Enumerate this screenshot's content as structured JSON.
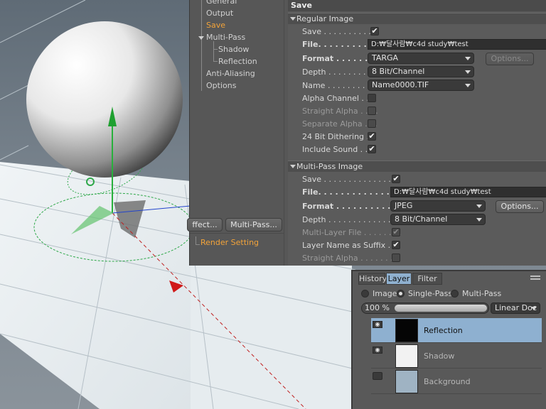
{
  "tree": {
    "items": [
      {
        "label": "General",
        "active": false
      },
      {
        "label": "Output",
        "active": false
      },
      {
        "label": "Save",
        "active": true
      },
      {
        "label": "Multi-Pass",
        "active": false
      },
      {
        "label": "Shadow",
        "active": false
      },
      {
        "label": "Reflection",
        "active": false
      },
      {
        "label": "Anti-Aliasing",
        "active": false
      },
      {
        "label": "Options",
        "active": false
      }
    ],
    "effect_button": "ffect...",
    "multipass_button": "Multi-Pass...",
    "render_setting": "Render Setting"
  },
  "settings": {
    "title": "Save",
    "regular": {
      "header": "Regular Image",
      "save_label": "Save . . . . . . . . . . .",
      "save_checked": "✔",
      "file_label": "File. . . . . . . . . . . . .",
      "file_value": "D:₩달사람₩c4d study₩test",
      "format_label": "Format . . . . . . . . .",
      "format_value": "TARGA",
      "options_button": "Options...",
      "depth_label": "Depth . . . . . . . . . .",
      "depth_value": "8 Bit/Channel",
      "name_label": "Name . . . . . . . . . . .",
      "name_value": "Name0000.TIF",
      "alpha_label": "Alpha Channel . .",
      "straight_label": "Straight Alpha . . . .",
      "separate_label": "Separate Alpha . . .",
      "dither_label": "24 Bit Dithering . .",
      "dither_checked": "✔",
      "sound_label": "Include Sound . . .",
      "sound_checked": "✔"
    },
    "multipass": {
      "header": "Multi-Pass Image",
      "save_label": "Save . . . . . . . . . . . . . . .",
      "save_checked": "✔",
      "file_label": "File. . . . . . . . . . . . . . . . .",
      "file_value": "D:₩달사람₩c4d study₩test",
      "format_label": "Format . . . . . . . . . . . .",
      "format_value": "JPEG",
      "options_button": "Options...",
      "depth_label": "Depth . . . . . . . . . . . . . .",
      "depth_value": "8 Bit/Channel",
      "layerfile_label": "Multi-Layer File . . . . . . . .",
      "layerfile_checked": "✔",
      "suffix_label": "Layer Name as Suffix . . .",
      "suffix_checked": "✔",
      "straight_label": "Straight Alpha . . . . . . ."
    }
  },
  "layers": {
    "tabs": [
      "History",
      "Layer",
      "Filter"
    ],
    "active_tab": "Layer",
    "modes": [
      "Image",
      "Single-Pass",
      "Multi-Pass"
    ],
    "selected_mode": "Single-Pass",
    "opacity": "100 %",
    "blend_mode": "Linear Doc",
    "rows": [
      {
        "name": "Reflection",
        "selected": true
      },
      {
        "name": "Shadow",
        "selected": false
      },
      {
        "name": "Background",
        "selected": false
      }
    ]
  },
  "colors": {
    "accent_orange": "#f2a33a",
    "selection_blue": "#8eb0d0"
  }
}
